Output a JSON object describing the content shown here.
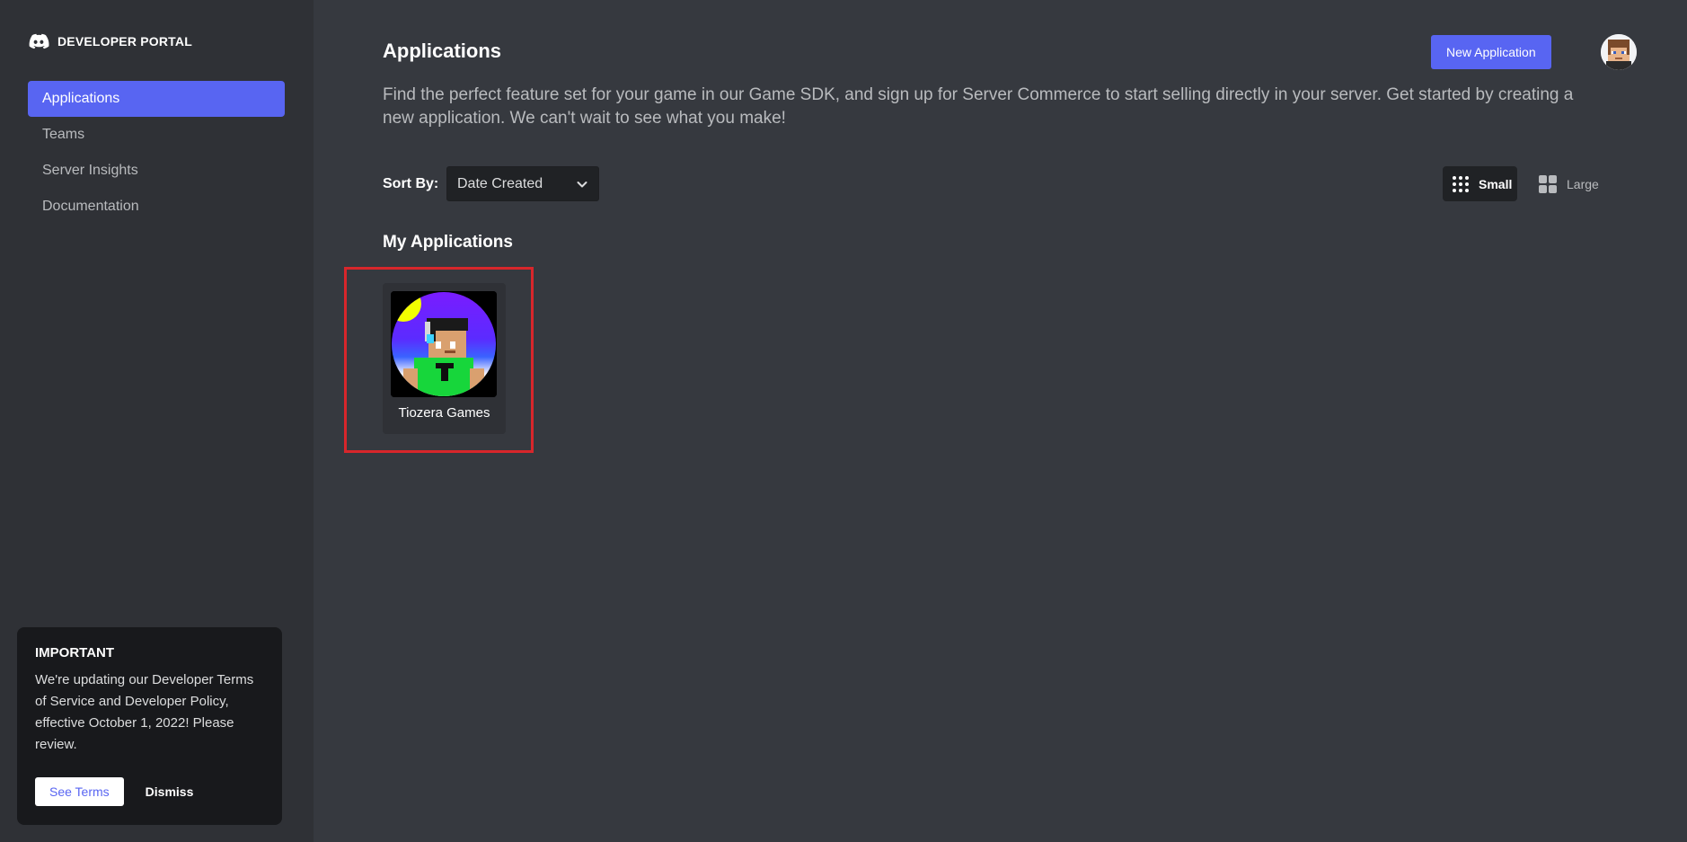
{
  "brand": {
    "name": "DEVELOPER PORTAL"
  },
  "sidebar": {
    "items": [
      {
        "label": "Applications",
        "active": true
      },
      {
        "label": "Teams",
        "active": false
      },
      {
        "label": "Server Insights",
        "active": false
      },
      {
        "label": "Documentation",
        "active": false
      }
    ]
  },
  "notice": {
    "title": "IMPORTANT",
    "body": "We're updating our Developer Terms of Service and Developer Policy, effective October 1, 2022! Please review.",
    "primary_label": "See Terms",
    "secondary_label": "Dismiss"
  },
  "header": {
    "title": "Applications",
    "new_button_label": "New Application",
    "intro": "Find the perfect feature set for your game in our Game SDK, and sign up for Server Commerce to start selling directly in your server. Get started by creating a new application. We can't wait to see what you make!"
  },
  "sort": {
    "label": "Sort By:",
    "value": "Date Created"
  },
  "view_toggle": {
    "small_label": "Small",
    "large_label": "Large",
    "selected": "Small"
  },
  "my_applications": {
    "title": "My Applications",
    "apps": [
      {
        "name": "Tiozera Games"
      }
    ]
  },
  "colors": {
    "accent": "#5865f2",
    "sidebar_bg": "#2f3136",
    "main_bg": "#36393f",
    "highlight": "#d8262b"
  },
  "icons": [
    "discord-logo-icon",
    "chevron-down-icon",
    "grid-small-icon",
    "grid-large-icon"
  ]
}
